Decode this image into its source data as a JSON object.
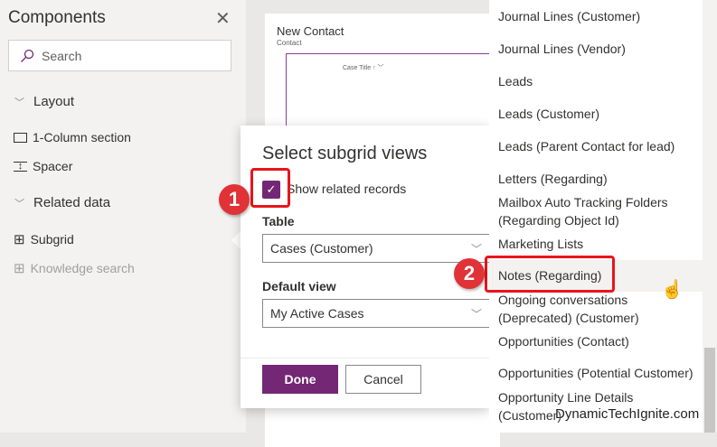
{
  "panel": {
    "title": "Components",
    "search_placeholder": "Search",
    "sections": [
      {
        "label": "Layout",
        "items": [
          "1-Column section",
          "Spacer"
        ]
      },
      {
        "label": "Related data",
        "items": [
          "Subgrid",
          "Knowledge search"
        ]
      }
    ]
  },
  "form": {
    "title": "New Contact",
    "subtitle": "Contact",
    "grid_header": "Case Title"
  },
  "dialog": {
    "title": "Select subgrid views",
    "show_related_label": "Show related records",
    "show_related_checked": true,
    "table_label": "Table",
    "table_value": "Cases (Customer)",
    "view_label": "Default view",
    "view_value": "My Active Cases",
    "done": "Done",
    "cancel": "Cancel"
  },
  "dropdown": {
    "options": [
      "Journal Lines (Customer)",
      "Journal Lines (Vendor)",
      "Leads",
      "Leads (Customer)",
      "Leads (Parent Contact for lead)",
      "Letters (Regarding)",
      "Mailbox Auto Tracking Folders (Regarding Object Id)",
      "Marketing Lists",
      "Notes (Regarding)",
      "Ongoing conversations (Deprecated) (Customer)",
      "Opportunities (Contact)",
      "Opportunities (Potential Customer)",
      "Opportunity Line Details (Customer)"
    ],
    "hovered": "Notes (Regarding)"
  },
  "annotations": {
    "step1": "1",
    "step2": "2"
  },
  "watermark": "DynamicTechIgnite.com",
  "colors": {
    "accent": "#742774",
    "annotation": "#e8141c"
  }
}
